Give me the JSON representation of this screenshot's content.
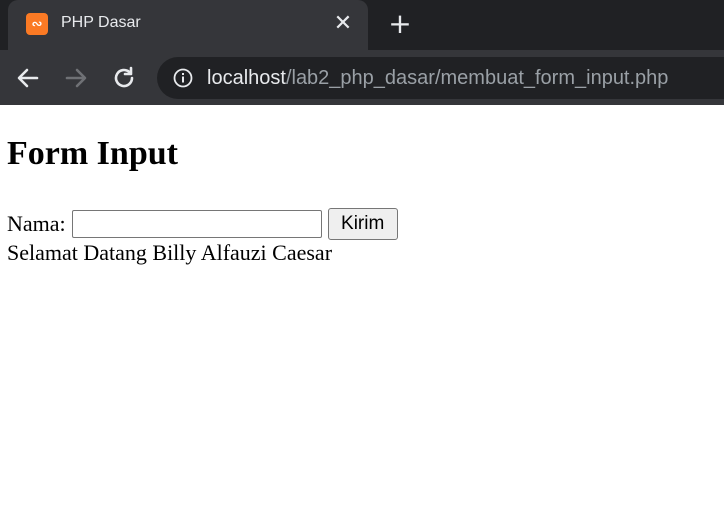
{
  "browser": {
    "tab": {
      "title": "PHP Dasar",
      "favicon": "xampp-icon",
      "favicon_color": "#fb7a24",
      "close_label": "✕"
    },
    "new_tab_label": "+",
    "nav": {
      "back": "back-arrow-icon",
      "forward": "forward-arrow-icon",
      "reload": "reload-icon"
    },
    "address_bar": {
      "host": "localhost",
      "path": "/lab2_php_dasar/membuat_form_input.php",
      "info_icon": "info-icon"
    },
    "colors": {
      "tabstrip": "#202124",
      "toolbar": "#35363a",
      "omnibox": "#202124"
    }
  },
  "page": {
    "heading": "Form Input",
    "form": {
      "label": "Nama:",
      "input_value": "",
      "submit_label": "Kirim"
    },
    "greeting": "Selamat Datang Billy Alfauzi Caesar"
  }
}
